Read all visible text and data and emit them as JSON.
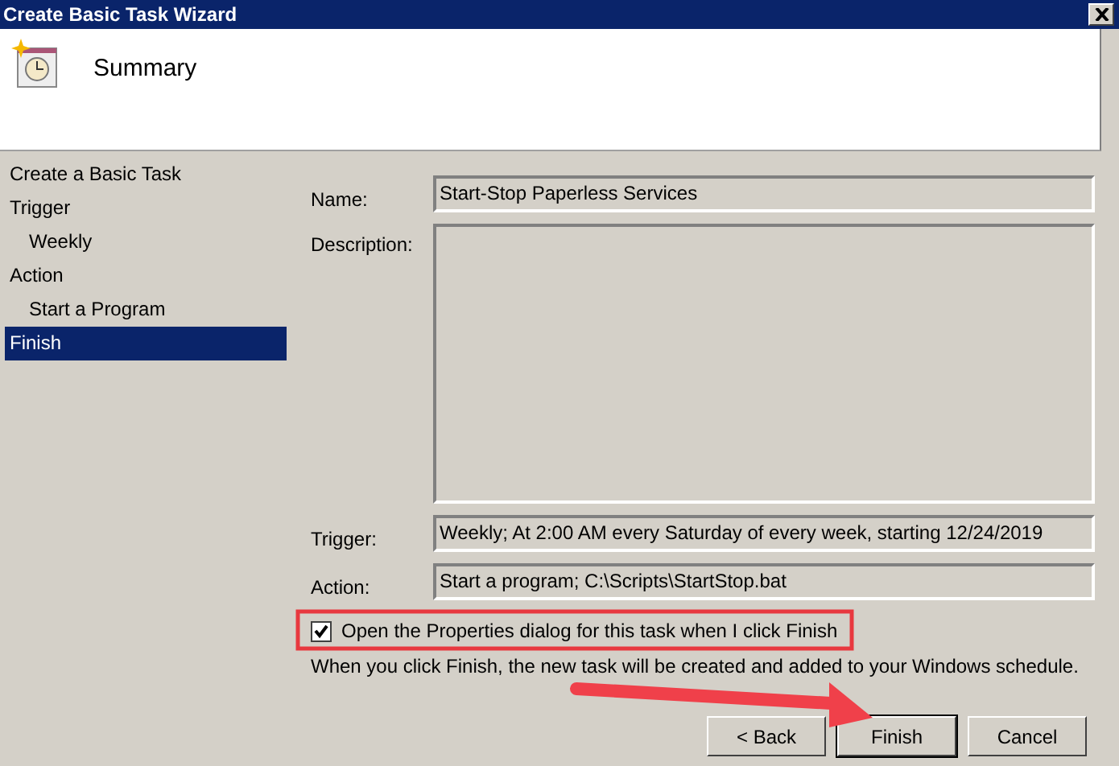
{
  "window": {
    "title": "Create Basic Task Wizard"
  },
  "header": {
    "title": "Summary"
  },
  "sidebar": {
    "items": [
      {
        "label": "Create a Basic Task",
        "selected": false
      },
      {
        "label": "Trigger",
        "selected": false,
        "children": [
          {
            "label": "Weekly",
            "selected": false
          }
        ]
      },
      {
        "label": "Action",
        "selected": false,
        "children": [
          {
            "label": "Start a Program",
            "selected": false
          }
        ]
      },
      {
        "label": "Finish",
        "selected": true
      }
    ]
  },
  "fields": [
    {
      "label": "Name:",
      "value": "Start-Stop Paperless Services",
      "kind": "line"
    },
    {
      "label": "Description:",
      "kind": "area"
    },
    {
      "label": "Trigger:",
      "value": "Weekly; At 2:00 AM every Saturday of every week, starting 12/24/2019",
      "kind": "line"
    },
    {
      "label": "Action:",
      "value": "Start a program; C:\\Scripts\\StartStop.bat",
      "kind": "line"
    }
  ],
  "open_properties": {
    "label": "Open the Properties dialog for this task when I click Finish",
    "checked": true,
    "highlighted": true
  },
  "info": "When you click Finish, the new task will be created and added to your Windows schedule.",
  "buttons": [
    {
      "label": "< Back",
      "default": false
    },
    {
      "label": "Finish",
      "default": true
    },
    {
      "label": "Cancel",
      "default": false
    }
  ],
  "annotations": [
    {
      "kind": "arrow"
    }
  ]
}
